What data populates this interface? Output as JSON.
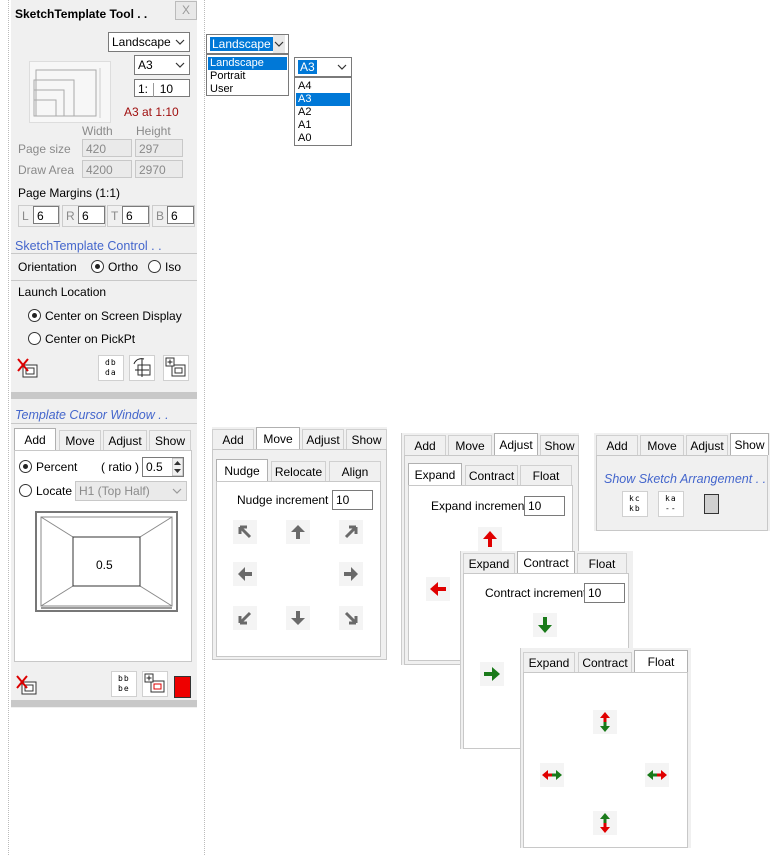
{
  "tool": {
    "title": "SketchTemplate Tool . .",
    "close": "X",
    "orientation_value": "Landscape",
    "paper_value": "A3",
    "scale_prefix": "1:",
    "scale_value": "10",
    "scale_caption": "A3 at 1:10",
    "col_width": "Width",
    "col_height": "Height",
    "page_size_label": "Page size",
    "page_w": "420",
    "page_h": "297",
    "draw_area_label": "Draw Area",
    "draw_w": "4200",
    "draw_h": "2970",
    "margins_label": "Page Margins (1:1)",
    "margins": [
      {
        "k": "L",
        "v": "6"
      },
      {
        "k": "R",
        "v": "6"
      },
      {
        "k": "T",
        "v": "6"
      },
      {
        "k": "B",
        "v": "6"
      }
    ]
  },
  "control": {
    "title": "SketchTemplate Control . .",
    "orientation_label": "Orientation",
    "ortho": "Ortho",
    "iso": "Iso",
    "launch_label": "Launch Location",
    "center_screen": "Center on Screen Display",
    "center_pick": "Center on PickPt",
    "icon_text_1": "db",
    "icon_text_2": "da"
  },
  "cursor": {
    "title": "Template Cursor Window . .",
    "tabs": [
      "Add",
      "Move",
      "Adjust",
      "Show"
    ],
    "percent": "Percent",
    "ratio": "( ratio )",
    "ratio_value": "0.5",
    "locate": "Locate",
    "locate_value": "H1  (Top Half)",
    "preview_value": "0.5",
    "icon_text_1": "bb",
    "icon_text_2": "be",
    "swatch_color": "#ee0000"
  },
  "dropdown_orientation": {
    "value": "Landscape",
    "options": [
      "Landscape",
      "Portrait",
      "User"
    ]
  },
  "dropdown_paper": {
    "value": "A3",
    "options": [
      "A4",
      "A3",
      "A2",
      "A1",
      "A0"
    ]
  },
  "move_panel": {
    "tabs": [
      "Add",
      "Move",
      "Adjust",
      "Show"
    ],
    "subtabs": [
      "Nudge",
      "Relocate",
      "Align"
    ],
    "increment_label": "Nudge increment",
    "increment_value": "10"
  },
  "adjust_panel": {
    "tabs": [
      "Add",
      "Move",
      "Adjust",
      "Show"
    ],
    "subtabs": [
      "Expand",
      "Contract",
      "Float"
    ],
    "increment_label": "Expand increment",
    "increment_value": "10"
  },
  "show_panel": {
    "tabs": [
      "Add",
      "Move",
      "Adjust",
      "Show"
    ],
    "title": "Show Sketch Arrangement . .",
    "icon1_a": "kc",
    "icon1_b": "kb",
    "icon2_a": "ka",
    "icon2_b": "--"
  },
  "contract_panel": {
    "subtabs": [
      "Expand",
      "Contract",
      "Float"
    ],
    "increment_label": "Contract increment",
    "increment_value": "10"
  },
  "float_panel": {
    "subtabs": [
      "Expand",
      "Contract",
      "Float"
    ]
  },
  "colors": {
    "red": "#e00000",
    "green": "#1a7a1a",
    "gray_arrow": "#6a6a6a",
    "accent": "#6f9fd8"
  }
}
